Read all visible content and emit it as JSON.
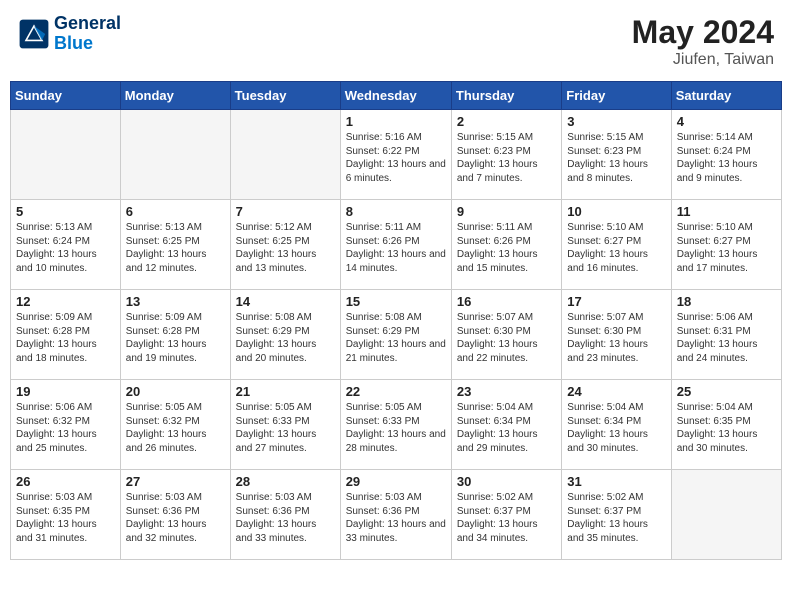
{
  "header": {
    "logo_line1": "General",
    "logo_line2": "Blue",
    "month_year": "May 2024",
    "location": "Jiufen, Taiwan"
  },
  "days_of_week": [
    "Sunday",
    "Monday",
    "Tuesday",
    "Wednesday",
    "Thursday",
    "Friday",
    "Saturday"
  ],
  "weeks": [
    [
      {
        "day": "",
        "info": ""
      },
      {
        "day": "",
        "info": ""
      },
      {
        "day": "",
        "info": ""
      },
      {
        "day": "1",
        "info": "Sunrise: 5:16 AM\nSunset: 6:22 PM\nDaylight: 13 hours and 6 minutes."
      },
      {
        "day": "2",
        "info": "Sunrise: 5:15 AM\nSunset: 6:23 PM\nDaylight: 13 hours and 7 minutes."
      },
      {
        "day": "3",
        "info": "Sunrise: 5:15 AM\nSunset: 6:23 PM\nDaylight: 13 hours and 8 minutes."
      },
      {
        "day": "4",
        "info": "Sunrise: 5:14 AM\nSunset: 6:24 PM\nDaylight: 13 hours and 9 minutes."
      }
    ],
    [
      {
        "day": "5",
        "info": "Sunrise: 5:13 AM\nSunset: 6:24 PM\nDaylight: 13 hours and 10 minutes."
      },
      {
        "day": "6",
        "info": "Sunrise: 5:13 AM\nSunset: 6:25 PM\nDaylight: 13 hours and 12 minutes."
      },
      {
        "day": "7",
        "info": "Sunrise: 5:12 AM\nSunset: 6:25 PM\nDaylight: 13 hours and 13 minutes."
      },
      {
        "day": "8",
        "info": "Sunrise: 5:11 AM\nSunset: 6:26 PM\nDaylight: 13 hours and 14 minutes."
      },
      {
        "day": "9",
        "info": "Sunrise: 5:11 AM\nSunset: 6:26 PM\nDaylight: 13 hours and 15 minutes."
      },
      {
        "day": "10",
        "info": "Sunrise: 5:10 AM\nSunset: 6:27 PM\nDaylight: 13 hours and 16 minutes."
      },
      {
        "day": "11",
        "info": "Sunrise: 5:10 AM\nSunset: 6:27 PM\nDaylight: 13 hours and 17 minutes."
      }
    ],
    [
      {
        "day": "12",
        "info": "Sunrise: 5:09 AM\nSunset: 6:28 PM\nDaylight: 13 hours and 18 minutes."
      },
      {
        "day": "13",
        "info": "Sunrise: 5:09 AM\nSunset: 6:28 PM\nDaylight: 13 hours and 19 minutes."
      },
      {
        "day": "14",
        "info": "Sunrise: 5:08 AM\nSunset: 6:29 PM\nDaylight: 13 hours and 20 minutes."
      },
      {
        "day": "15",
        "info": "Sunrise: 5:08 AM\nSunset: 6:29 PM\nDaylight: 13 hours and 21 minutes."
      },
      {
        "day": "16",
        "info": "Sunrise: 5:07 AM\nSunset: 6:30 PM\nDaylight: 13 hours and 22 minutes."
      },
      {
        "day": "17",
        "info": "Sunrise: 5:07 AM\nSunset: 6:30 PM\nDaylight: 13 hours and 23 minutes."
      },
      {
        "day": "18",
        "info": "Sunrise: 5:06 AM\nSunset: 6:31 PM\nDaylight: 13 hours and 24 minutes."
      }
    ],
    [
      {
        "day": "19",
        "info": "Sunrise: 5:06 AM\nSunset: 6:32 PM\nDaylight: 13 hours and 25 minutes."
      },
      {
        "day": "20",
        "info": "Sunrise: 5:05 AM\nSunset: 6:32 PM\nDaylight: 13 hours and 26 minutes."
      },
      {
        "day": "21",
        "info": "Sunrise: 5:05 AM\nSunset: 6:33 PM\nDaylight: 13 hours and 27 minutes."
      },
      {
        "day": "22",
        "info": "Sunrise: 5:05 AM\nSunset: 6:33 PM\nDaylight: 13 hours and 28 minutes."
      },
      {
        "day": "23",
        "info": "Sunrise: 5:04 AM\nSunset: 6:34 PM\nDaylight: 13 hours and 29 minutes."
      },
      {
        "day": "24",
        "info": "Sunrise: 5:04 AM\nSunset: 6:34 PM\nDaylight: 13 hours and 30 minutes."
      },
      {
        "day": "25",
        "info": "Sunrise: 5:04 AM\nSunset: 6:35 PM\nDaylight: 13 hours and 30 minutes."
      }
    ],
    [
      {
        "day": "26",
        "info": "Sunrise: 5:03 AM\nSunset: 6:35 PM\nDaylight: 13 hours and 31 minutes."
      },
      {
        "day": "27",
        "info": "Sunrise: 5:03 AM\nSunset: 6:36 PM\nDaylight: 13 hours and 32 minutes."
      },
      {
        "day": "28",
        "info": "Sunrise: 5:03 AM\nSunset: 6:36 PM\nDaylight: 13 hours and 33 minutes."
      },
      {
        "day": "29",
        "info": "Sunrise: 5:03 AM\nSunset: 6:36 PM\nDaylight: 13 hours and 33 minutes."
      },
      {
        "day": "30",
        "info": "Sunrise: 5:02 AM\nSunset: 6:37 PM\nDaylight: 13 hours and 34 minutes."
      },
      {
        "day": "31",
        "info": "Sunrise: 5:02 AM\nSunset: 6:37 PM\nDaylight: 13 hours and 35 minutes."
      },
      {
        "day": "",
        "info": ""
      }
    ]
  ]
}
